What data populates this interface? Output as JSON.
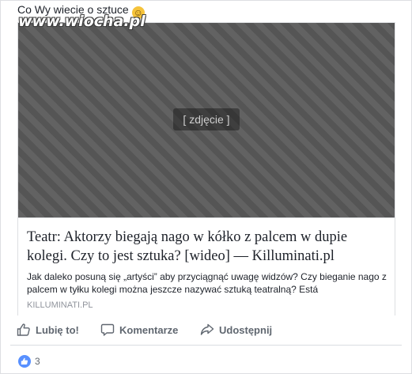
{
  "post": {
    "text": "Co Wy wiecie o sztuce",
    "emoji": "☺"
  },
  "watermark": "www.wiocha.pl",
  "card": {
    "title": "Teatr: Aktorzy biegają nago w kółko z palcem w dupie kolegi. Czy to jest sztuka? [wideo] — Killuminati.pl",
    "description": "Jak daleko posuną się „artyści” aby przyciągnąć uwagę widzów? Czy bieganie nago z palcem w tyłku kolegi można jeszcze nazywać sztuką teatralną? Está",
    "domain": "KILLUMINATI.PL"
  },
  "actions": {
    "like": "Lubię to!",
    "comment": "Komentarze",
    "share": "Udostępnij"
  },
  "reactions": {
    "count": "3"
  },
  "colors": {
    "accent": "#5890ff",
    "action_text": "#606770",
    "domain_text": "#90949c"
  }
}
